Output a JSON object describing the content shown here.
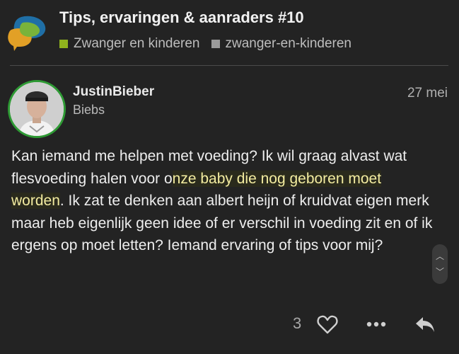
{
  "topic": {
    "title": "Tips, ervaringen & aanraders #10",
    "categories": [
      {
        "label": "Zwanger en kinderen",
        "color": "#8fb31d"
      },
      {
        "label": "zwanger-en-kinderen",
        "color": "#9a9a9a"
      }
    ]
  },
  "post": {
    "username": "JustinBieber",
    "full_name": "Biebs",
    "date": "27 mei",
    "body_before": "Kan iemand me helpen met voeding? Ik wil graag alvast wat flesvoeding halen voor o",
    "body_highlight": "nze baby die nog geboren moet worden",
    "body_after": ". Ik zat te denken aan albert heijn of kruidvat eigen merk maar heb eigenlijk geen idee of er verschil in voeding zit en of ik ergens op moet letten? Iemand ervaring of tips voor mij?",
    "like_count": "3"
  },
  "icons": {
    "logo": "chat-bubbles-logo",
    "like": "heart-icon",
    "more": "ellipsis-icon",
    "reply": "reply-arrow-icon",
    "scroll_up": "chevron-up-icon",
    "scroll_down": "chevron-down-icon"
  },
  "colors": {
    "background": "#232323",
    "avatar_ring": "#2e9a34",
    "highlight_text": "#f3eca0"
  }
}
